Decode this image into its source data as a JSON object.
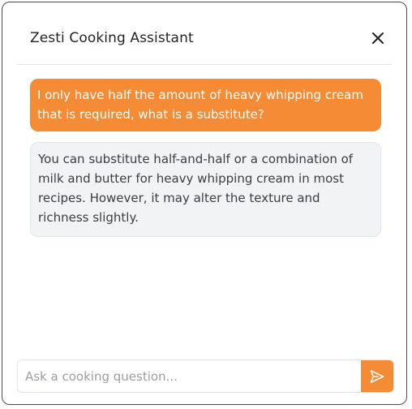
{
  "window": {
    "title": "Zesti Cooking Assistant",
    "close_icon": "close-icon"
  },
  "conversation": {
    "messages": [
      {
        "role": "user",
        "text": "I only have half the amount of heavy whipping cream that is required, what is a substitute?"
      },
      {
        "role": "assistant",
        "text": "You can substitute half-and-half or a combination of milk and butter for heavy whipping cream in most recipes. However, it may alter the texture and richness slightly."
      }
    ]
  },
  "composer": {
    "value": "",
    "placeholder": "Ask a cooking question...",
    "send_icon": "send-icon"
  },
  "colors": {
    "accent": "#f58b34",
    "assistant_bubble": "#f2f3f5",
    "user_text": "#ffffff"
  }
}
